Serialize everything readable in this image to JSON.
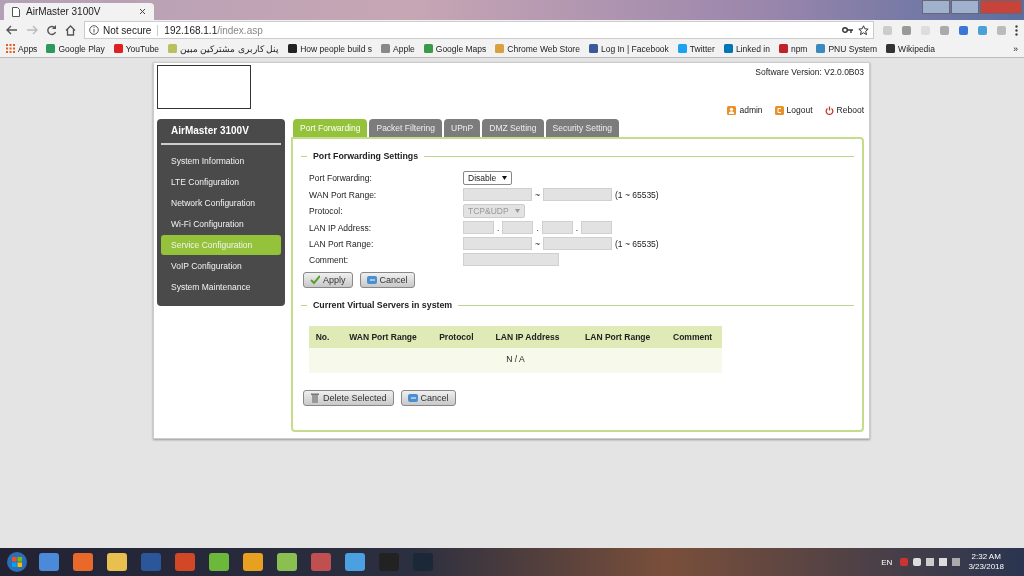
{
  "browser": {
    "tab_title": "AirMaster 3100V",
    "security": "Not secure",
    "url_host": "192.168.1.1",
    "url_path": "/index.asp",
    "bookmarks": [
      {
        "label": "Apps"
      },
      {
        "label": "Google Play"
      },
      {
        "label": "YouTube"
      },
      {
        "label": "پنل کاربری مشترکین مبین"
      },
      {
        "label": "How people build s"
      },
      {
        "label": "Apple"
      },
      {
        "label": "Google Maps"
      },
      {
        "label": "Chrome Web Store"
      },
      {
        "label": "Log In | Facebook"
      },
      {
        "label": "Twitter"
      },
      {
        "label": "Linked in"
      },
      {
        "label": "npm"
      },
      {
        "label": "PNU System"
      },
      {
        "label": "Wikipedia"
      }
    ],
    "more": "»"
  },
  "header": {
    "software_version": "Software Version: V2.0.0B03",
    "user": "admin",
    "logout": "Logout",
    "reboot": "Reboot"
  },
  "sidebar": {
    "title": "AirMaster 3100V",
    "items": [
      {
        "label": "System Information",
        "selected": false
      },
      {
        "label": "LTE Configuration",
        "selected": false
      },
      {
        "label": "Network Configuration",
        "selected": false
      },
      {
        "label": "Wi-Fi Configuration",
        "selected": false
      },
      {
        "label": "Service Configuration",
        "selected": true
      },
      {
        "label": "VoIP Configuration",
        "selected": false
      },
      {
        "label": "System Maintenance",
        "selected": false
      }
    ]
  },
  "tabs": [
    {
      "label": "Port Forwarding",
      "selected": true
    },
    {
      "label": "Packet Filtering",
      "selected": false
    },
    {
      "label": "UPnP",
      "selected": false
    },
    {
      "label": "DMZ Setting",
      "selected": false
    },
    {
      "label": "Security Setting",
      "selected": false
    }
  ],
  "settings": {
    "title": "Port Forwarding Settings",
    "fields": [
      {
        "label": "Port Forwarding:",
        "kind": "select",
        "value": "Disable",
        "disabled": false
      },
      {
        "label": "WAN Port Range:",
        "kind": "range",
        "separator": "~",
        "hint": "(1 ~ 65535)",
        "disabled": true
      },
      {
        "label": "Protocol:",
        "kind": "select",
        "value": "TCP&UDP",
        "disabled": true
      },
      {
        "label": "LAN IP Address:",
        "kind": "ip",
        "separator": ".",
        "disabled": true
      },
      {
        "label": "LAN Port Range:",
        "kind": "range",
        "separator": "~",
        "hint": "(1 ~ 65535)",
        "disabled": true
      },
      {
        "label": "Comment:",
        "kind": "text",
        "disabled": true
      }
    ],
    "buttons": [
      {
        "label": "Apply",
        "kind": "apply"
      },
      {
        "label": "Cancel",
        "kind": "cancel"
      }
    ]
  },
  "servers": {
    "title": "Current Virtual Servers in system",
    "columns": [
      "No.",
      "WAN Port Range",
      "Protocol",
      "LAN IP Address",
      "LAN Port Range",
      "Comment"
    ],
    "empty": "N / A",
    "buttons": [
      {
        "label": "Delete Selected",
        "kind": "delete"
      },
      {
        "label": "Cancel",
        "kind": "cancel"
      }
    ]
  },
  "taskbar": {
    "language": "EN",
    "time": "2:32 AM",
    "date": "3/23/2018"
  }
}
